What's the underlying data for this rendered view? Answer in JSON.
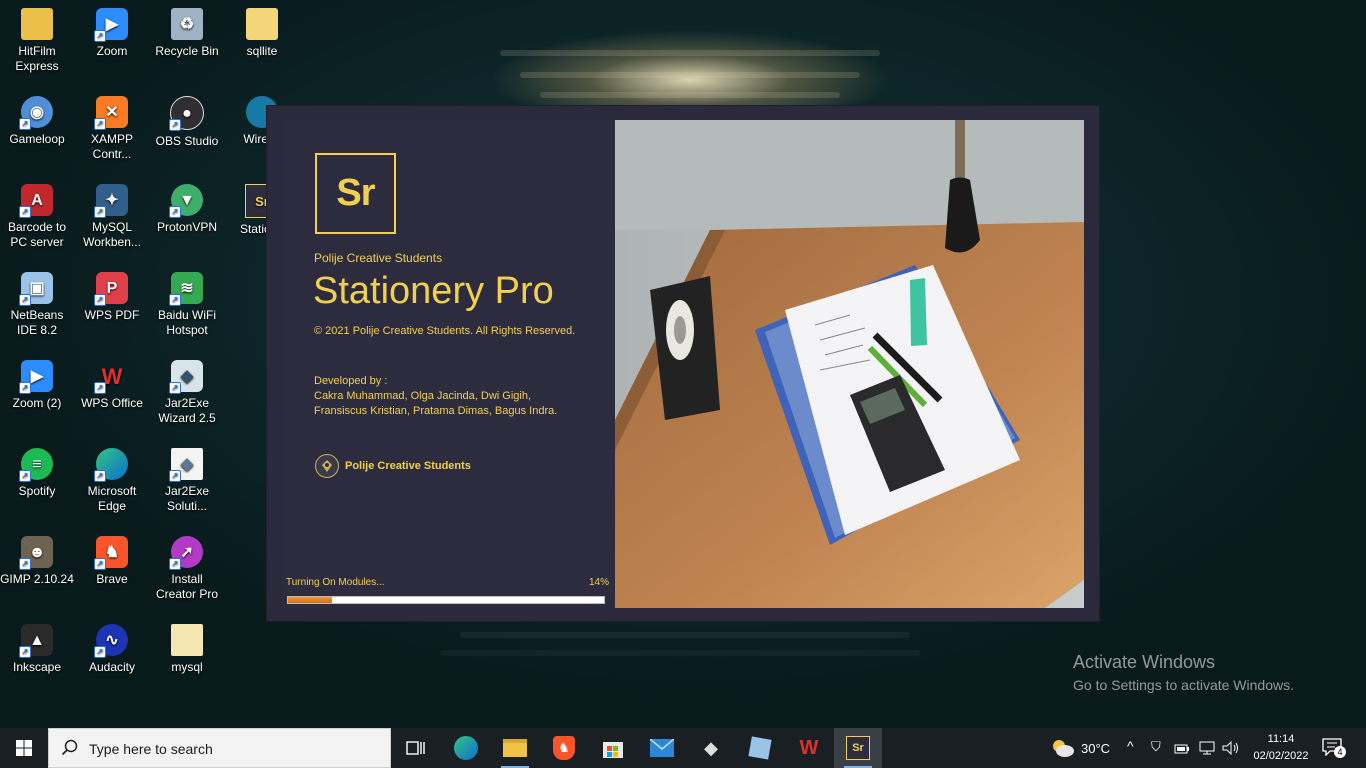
{
  "desktop": {
    "icons": [
      {
        "label": "HitFilm Express",
        "icon": "folder-icon"
      },
      {
        "label": "Zoom",
        "icon": "zoom-icon"
      },
      {
        "label": "Recycle Bin",
        "icon": "recycle-bin-icon"
      },
      {
        "label": "sqllite",
        "icon": "folder-icon"
      },
      {
        "label": "Gameloop",
        "icon": "gameloop-icon"
      },
      {
        "label": "XAMPP Contr...",
        "icon": "xampp-icon"
      },
      {
        "label": "OBS Studio",
        "icon": "obs-icon"
      },
      {
        "label": "Wiresh",
        "icon": "wireshark-icon"
      },
      {
        "label": "Barcode to PC server",
        "icon": "barcode-icon"
      },
      {
        "label": "MySQL Workben...",
        "icon": "mysql-icon"
      },
      {
        "label": "ProtonVPN",
        "icon": "protonvpn-icon"
      },
      {
        "label": "Statione",
        "icon": "stationery-icon"
      },
      {
        "label": "NetBeans IDE 8.2",
        "icon": "netbeans-icon"
      },
      {
        "label": "WPS PDF",
        "icon": "wps-pdf-icon"
      },
      {
        "label": "Baidu WiFi Hotspot",
        "icon": "wifi-hotspot-icon"
      },
      {
        "label": "Zoom (2)",
        "icon": "zoom-icon"
      },
      {
        "label": "WPS Office",
        "icon": "wps-office-icon"
      },
      {
        "label": "Jar2Exe Wizard 2.5",
        "icon": "jar2exe-icon"
      },
      {
        "label": "Spotify",
        "icon": "spotify-icon"
      },
      {
        "label": "Microsoft Edge",
        "icon": "edge-icon"
      },
      {
        "label": "Jar2Exe Soluti...",
        "icon": "jar2exe-file-icon"
      },
      {
        "label": "GIMP 2.10.24",
        "icon": "gimp-icon"
      },
      {
        "label": "Brave",
        "icon": "brave-icon"
      },
      {
        "label": "Install Creator Pro",
        "icon": "install-creator-icon"
      },
      {
        "label": "Inkscape",
        "icon": "inkscape-icon"
      },
      {
        "label": "Audacity",
        "icon": "audacity-icon"
      },
      {
        "label": "mysql",
        "icon": "folder-icon"
      }
    ]
  },
  "splash": {
    "logo_text": "Sr",
    "org_small": "Polije Creative Students",
    "app_title": "Stationery Pro",
    "copyright": "© 2021 Polije Creative Students. All Rights Reserved.",
    "developed_by": "Developed by :",
    "developers_line1": "Cakra Muhammad, Olga Jacinda, Dwi Gigih,",
    "developers_line2": "Fransiscus Kristian, Pratama Dimas, Bagus Indra.",
    "footer_org": "Polije Creative Students",
    "status": "Turning On Modules...",
    "percent": "14%",
    "progress": 0.14,
    "accent": "#f2d04e"
  },
  "watermark": {
    "title": "Activate Windows",
    "subtitle": "Go to Settings to activate Windows."
  },
  "taskbar": {
    "search_placeholder": "Type here to search",
    "apps": [
      "task-view-icon",
      "edge-icon",
      "file-explorer-icon",
      "brave-icon",
      "microsoft-store-icon",
      "mail-icon",
      "inkscape-icon",
      "netbeans-icon",
      "wps-office-icon",
      "stationery-pro-icon"
    ],
    "weather_temp": "30°C",
    "time": "11:14",
    "date": "02/02/2022",
    "notification_count": "4"
  }
}
